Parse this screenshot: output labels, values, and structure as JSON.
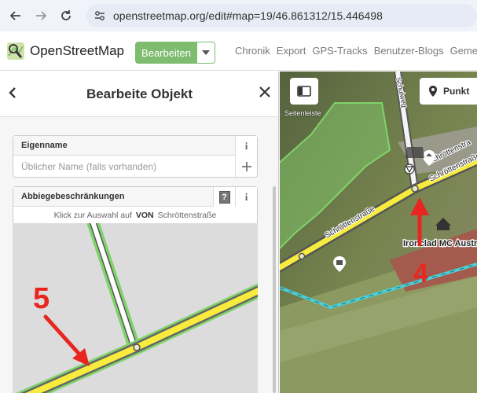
{
  "browser": {
    "url": "openstreetmap.org/edit#map=19/46.861312/15.446498"
  },
  "header": {
    "site_name": "OpenStreetMap",
    "edit_label": "Bearbeiten",
    "nav": [
      "Chronik",
      "Export",
      "GPS-Tracks",
      "Benutzer-Blogs",
      "Gemeinsc"
    ]
  },
  "sidebar": {
    "title": "Bearbeite Objekt",
    "name_field": {
      "label": "Eigenname",
      "placeholder": "Üblicher Name (falls vorhanden)",
      "info": "i"
    },
    "turn_field": {
      "label": "Abbiegebeschränkungen",
      "help": "?",
      "info": "i",
      "hint_prefix": "Klick zur Auswahl auf",
      "hint_keyword": "VON",
      "hint_street": "Schröttenstraße"
    },
    "annotation": "5"
  },
  "map": {
    "sidebar_toggle_label": "Seitenleiste",
    "point_label": "Punkt",
    "street_labels": [
      "Schulweg",
      "Schröttenstraße",
      "Schröttenstraße",
      "Schröttenstra"
    ],
    "poi_label": "Ironclad MC Austri",
    "annotation": "4"
  },
  "colors": {
    "osm_green": "#7ebc6f",
    "road_yellow": "#f7ec3e",
    "selected_green": "#7fd36a",
    "annotation_red": "#e8261f"
  }
}
